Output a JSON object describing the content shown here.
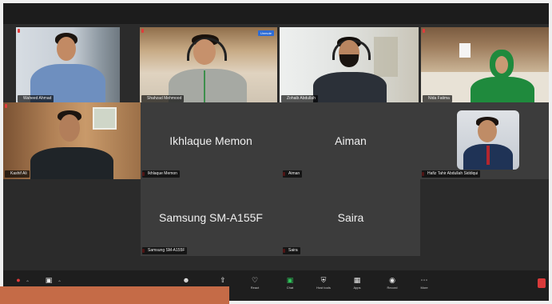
{
  "participants": [
    {
      "name": "Waheed Ahmad"
    },
    {
      "name": "Shahzad Mehmood"
    },
    {
      "name": "Zohaib Abdullah"
    },
    {
      "name": "Nida Fatima"
    },
    {
      "name": "Kashif Ali"
    },
    {
      "name": "Ikhlaque Memon",
      "label": "Ikhlaque Memon"
    },
    {
      "name": "Aiman",
      "label": "Aiman"
    },
    {
      "name": "Hafiz Tahir Abdullah Siddiqui"
    },
    {
      "name": "Samsung SM-A155F",
      "label": "Samsung SM-A155F"
    },
    {
      "name": "Saira",
      "label": "Saira"
    }
  ],
  "tile_badge": "Unmute",
  "toolbar": {
    "audio": "Audio",
    "video": "Video",
    "participants": "Participants",
    "share": "Share",
    "react": "React",
    "chat": "Chat",
    "host_tools": "Host tools",
    "apps": "Apps",
    "record": "Record",
    "more": "More"
  },
  "icons": [
    "mic-off-icon",
    "camera-icon",
    "participants-icon",
    "share-icon",
    "react-icon",
    "chat-icon",
    "shield-icon",
    "apps-icon",
    "record-icon",
    "more-icon"
  ],
  "colors": {
    "active_speaker": "#2fc45a",
    "muted": "#e23b3b",
    "end": "#d93a3a"
  }
}
